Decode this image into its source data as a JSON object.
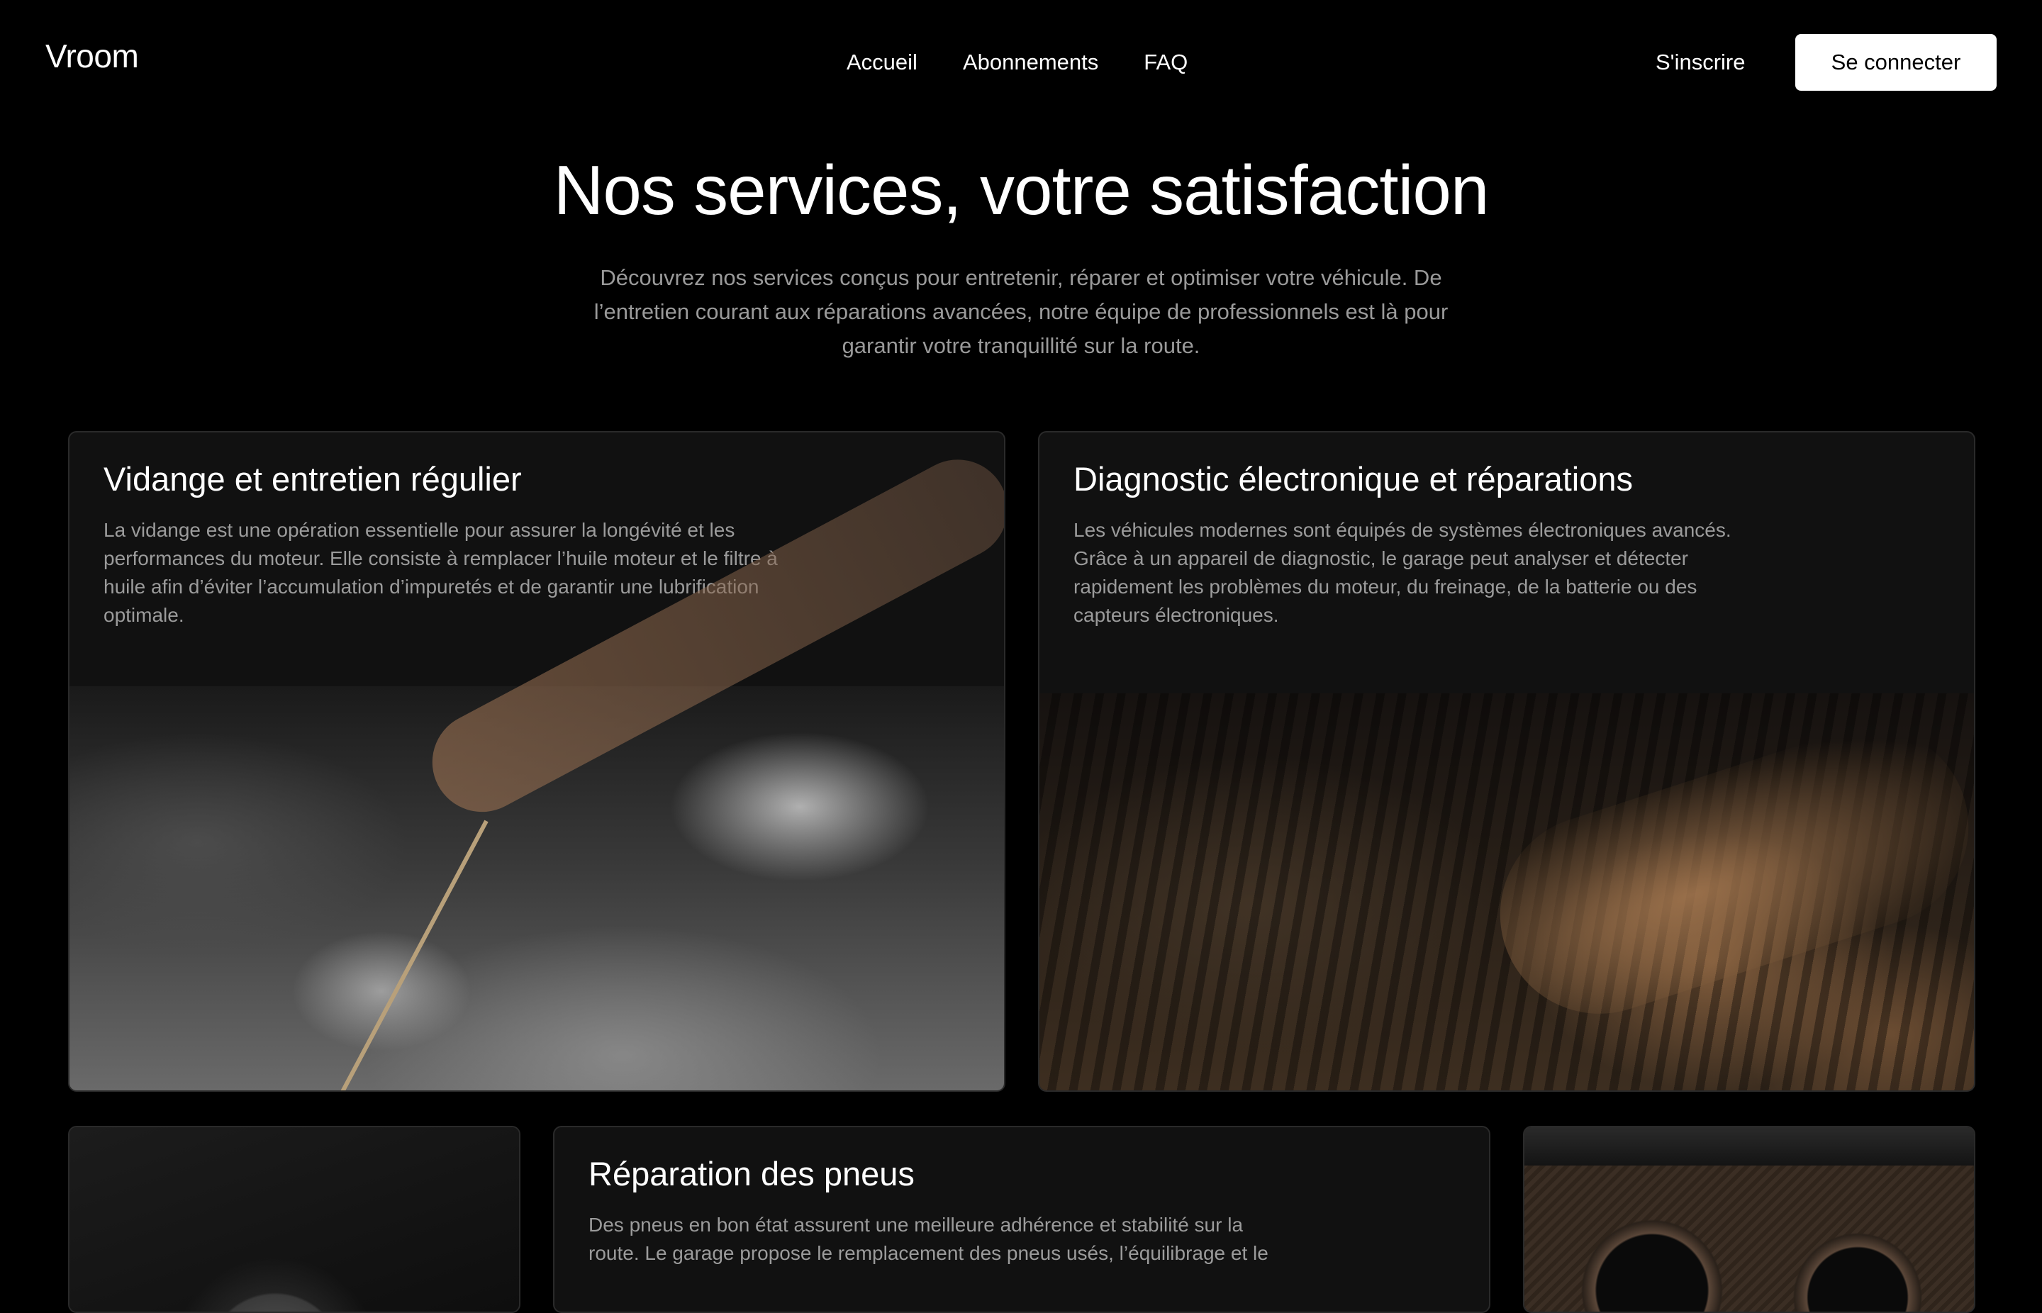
{
  "header": {
    "logo": "Vroom",
    "nav": [
      "Accueil",
      "Abonnements",
      "FAQ"
    ],
    "signup_label": "S'inscrire",
    "login_label": "Se connecter"
  },
  "hero": {
    "title": "Nos services, votre satisfaction",
    "subtitle": "Découvrez nos services conçus pour entretenir, réparer et optimiser votre véhicule. De l’entretien courant aux réparations avancées, notre équipe de professionnels est là pour garantir votre tranquillité sur la route."
  },
  "services": [
    {
      "title": "Vidange et entretien régulier",
      "text": "La vidange est une opération essentielle pour assurer la longévité et les performances du moteur. Elle consiste à remplacer l’huile moteur et le filtre à huile afin d’éviter l’accumulation d’impuretés et de garantir une lubrification optimale."
    },
    {
      "title": "Diagnostic électronique et réparations",
      "text": "Les véhicules modernes sont équipés de systèmes électroniques avancés. Grâce à un appareil de diagnostic, le garage peut analyser et détecter rapidement les problèmes du moteur, du freinage, de la batterie ou des capteurs électroniques."
    },
    {
      "title": "Réparation des pneus",
      "text": "Des pneus en bon état assurent une meilleure adhérence et stabilité sur la route. Le garage propose le remplacement des pneus usés, l’équilibrage et le"
    }
  ]
}
